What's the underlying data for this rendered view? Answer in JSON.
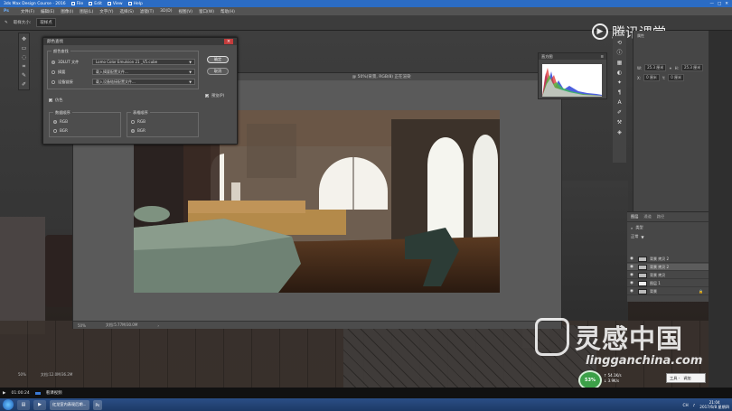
{
  "player_bar": {
    "title": "3ds Max Design Course · 2016",
    "items": [
      "File",
      "Edit",
      "View",
      "Help"
    ],
    "right": [
      "—",
      "□",
      "✕"
    ]
  },
  "menubar": {
    "logo": "Ps",
    "items": [
      "文件(F)",
      "编辑(E)",
      "图像(I)",
      "图层(L)",
      "文字(Y)",
      "选择(S)",
      "滤镜(T)",
      "3D(D)",
      "视图(V)",
      "窗口(W)",
      "帮助(H)"
    ]
  },
  "options": {
    "tool_label": "取样大小:",
    "tool_value": "取样点"
  },
  "document": {
    "title": "背景 拷贝 3, RGB/8",
    "title_right": "@ 50%(背景, RGB/8) 正在渲染",
    "zoom": "50%",
    "doc_size": "文档:5.77M/30.0M",
    "nav_arrow": "›"
  },
  "dialog": {
    "title": "颜色查找",
    "group_label": "颜色查找",
    "opt1_label": "3DLUT 文件",
    "opt1_value": "Lomo Color Emulsion 21 _V5.cube",
    "opt2_label": "摘要",
    "opt2_value": "载入摘要配置文件...",
    "opt3_label": "设备链接",
    "opt3_value": "载入设备链接配置文件...",
    "dither_label": "仿色",
    "preview_label": "预览(P)",
    "ok": "确定",
    "cancel": "取消",
    "data_order_label": "数据顺序",
    "data_order_opts": [
      "RGB",
      "BGR"
    ],
    "table_order_label": "表格顺序",
    "table_order_opts": [
      "RGB",
      "BGR"
    ]
  },
  "histogram": {
    "title": "直方图"
  },
  "properties": {
    "title": "属性",
    "w_label": "W:",
    "w_val": "25.3 厘米",
    "h_label": "H:",
    "h_val": "25.3 厘米",
    "x_label": "X:",
    "x_val": "0 厘米",
    "y_label": "Y:",
    "y_val": "0 厘米"
  },
  "layers": {
    "tabs": [
      "图层",
      "通道",
      "路径"
    ],
    "filter": "类型",
    "mode": "正常",
    "rows": [
      {
        "name": "背景 拷贝 2",
        "visible": true,
        "selected": false
      },
      {
        "name": "背景 拷贝 2",
        "visible": true,
        "selected": true
      },
      {
        "name": "背景 拷贝",
        "visible": true,
        "selected": false
      },
      {
        "name": "图层 1",
        "visible": true,
        "selected": false
      },
      {
        "name": "背景",
        "visible": true,
        "selected": false
      }
    ]
  },
  "watermarks": {
    "tencent": "腾讯课堂",
    "lg_cn": "灵感中国",
    "lg_url": "lingganchina.com"
  },
  "ps_status": {
    "zoom": "50%",
    "doc": "文档:12.0M/36.2M"
  },
  "speed_widget": {
    "percent": "53%",
    "up": "↑ 54.1K/s",
    "down": "↓ 3.9K/s"
  },
  "tooltip": {
    "left": "工具 -",
    "right": "调加"
  },
  "video": {
    "time": "01:00:24",
    "label": "看课视频"
  },
  "taskbar": {
    "tasks": [
      "红龙室内表现后期...",
      "Ps"
    ],
    "time": "21:04",
    "date": "2017/6/8 星期四",
    "lang": "CH"
  },
  "colors": {
    "player_blue": "#2b6cc4",
    "ps_gray": "#535353",
    "taskbar_blue": "#2a4e86"
  }
}
